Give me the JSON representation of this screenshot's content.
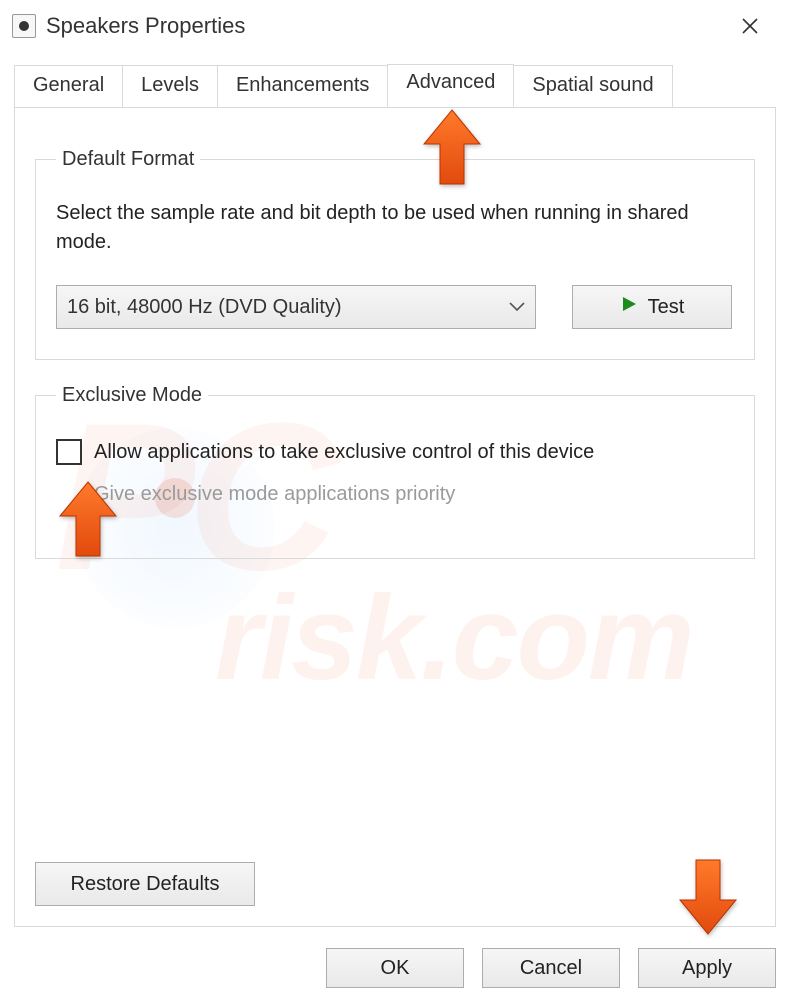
{
  "window": {
    "title": "Speakers Properties"
  },
  "tabs": {
    "general": "General",
    "levels": "Levels",
    "enhancements": "Enhancements",
    "advanced": "Advanced",
    "spatial": "Spatial sound",
    "active": "advanced"
  },
  "default_format": {
    "legend": "Default Format",
    "description": "Select the sample rate and bit depth to be used when running in shared mode.",
    "selected": "16 bit, 48000 Hz (DVD Quality)",
    "test_label": "Test"
  },
  "exclusive_mode": {
    "legend": "Exclusive Mode",
    "allow_label": "Allow applications to take exclusive control of this device",
    "allow_checked": false,
    "priority_label": "Give exclusive mode applications priority",
    "priority_enabled": false
  },
  "restore_label": "Restore Defaults",
  "buttons": {
    "ok": "OK",
    "cancel": "Cancel",
    "apply": "Apply"
  }
}
